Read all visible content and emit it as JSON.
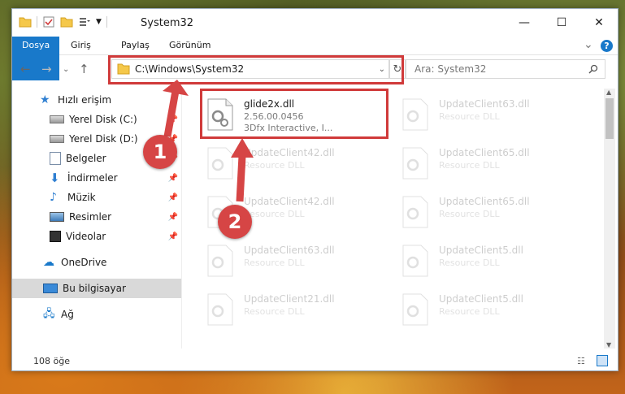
{
  "window": {
    "title": "System32",
    "min": "—",
    "max": "☐",
    "close": "✕"
  },
  "ribbon": {
    "tabs": [
      "Dosya",
      "Giriş",
      "Paylaş",
      "Görünüm"
    ],
    "collapse": "⌄",
    "help": "?"
  },
  "address": {
    "path": "C:\\Windows\\System32",
    "search_placeholder": "Ara: System32"
  },
  "sidebar": {
    "items": [
      {
        "label": "Hızlı erişim",
        "icon": "star-icon"
      },
      {
        "label": "Yerel Disk (C:)",
        "icon": "drive-icon",
        "pinned": true
      },
      {
        "label": "Yerel Disk (D:)",
        "icon": "drive-icon",
        "pinned": true
      },
      {
        "label": "Belgeler",
        "icon": "documents-icon",
        "pinned": true
      },
      {
        "label": "İndirmeler",
        "icon": "download-icon",
        "pinned": true
      },
      {
        "label": "Müzik",
        "icon": "music-icon",
        "pinned": true
      },
      {
        "label": "Resimler",
        "icon": "pictures-icon",
        "pinned": true
      },
      {
        "label": "Videolar",
        "icon": "videos-icon",
        "pinned": true
      },
      {
        "label": "OneDrive",
        "icon": "cloud-icon"
      },
      {
        "label": "Bu bilgisayar",
        "icon": "computer-icon",
        "selected": true
      },
      {
        "label": "Ağ",
        "icon": "network-icon"
      }
    ]
  },
  "files": {
    "highlight": {
      "name": "glide2x.dll",
      "version": "2.56.00.0456",
      "company": "3Dfx Interactive, I..."
    },
    "left": [
      {
        "name": "UpdateClient42.dll",
        "type": "Resource DLL"
      },
      {
        "name": "UpdateClient42.dll",
        "type": "Resource DLL"
      },
      {
        "name": "UpdateClient63.dll",
        "type": "Resource DLL"
      },
      {
        "name": "UpdateClient21.dll",
        "type": "Resource DLL"
      }
    ],
    "right": [
      {
        "name": "UpdateClient63.dll",
        "type": "Resource DLL"
      },
      {
        "name": "UpdateClient65.dll",
        "type": "Resource DLL"
      },
      {
        "name": "UpdateClient65.dll",
        "type": "Resource DLL"
      },
      {
        "name": "UpdateClient5.dll",
        "type": "Resource DLL"
      },
      {
        "name": "UpdateClient5.dll",
        "type": "Resource DLL"
      }
    ]
  },
  "markers": [
    "1",
    "2"
  ],
  "status": {
    "count": "108 öğe"
  },
  "colors": {
    "accent": "#1979ca",
    "highlight_border": "#d03a3a",
    "marker": "#d64545"
  }
}
